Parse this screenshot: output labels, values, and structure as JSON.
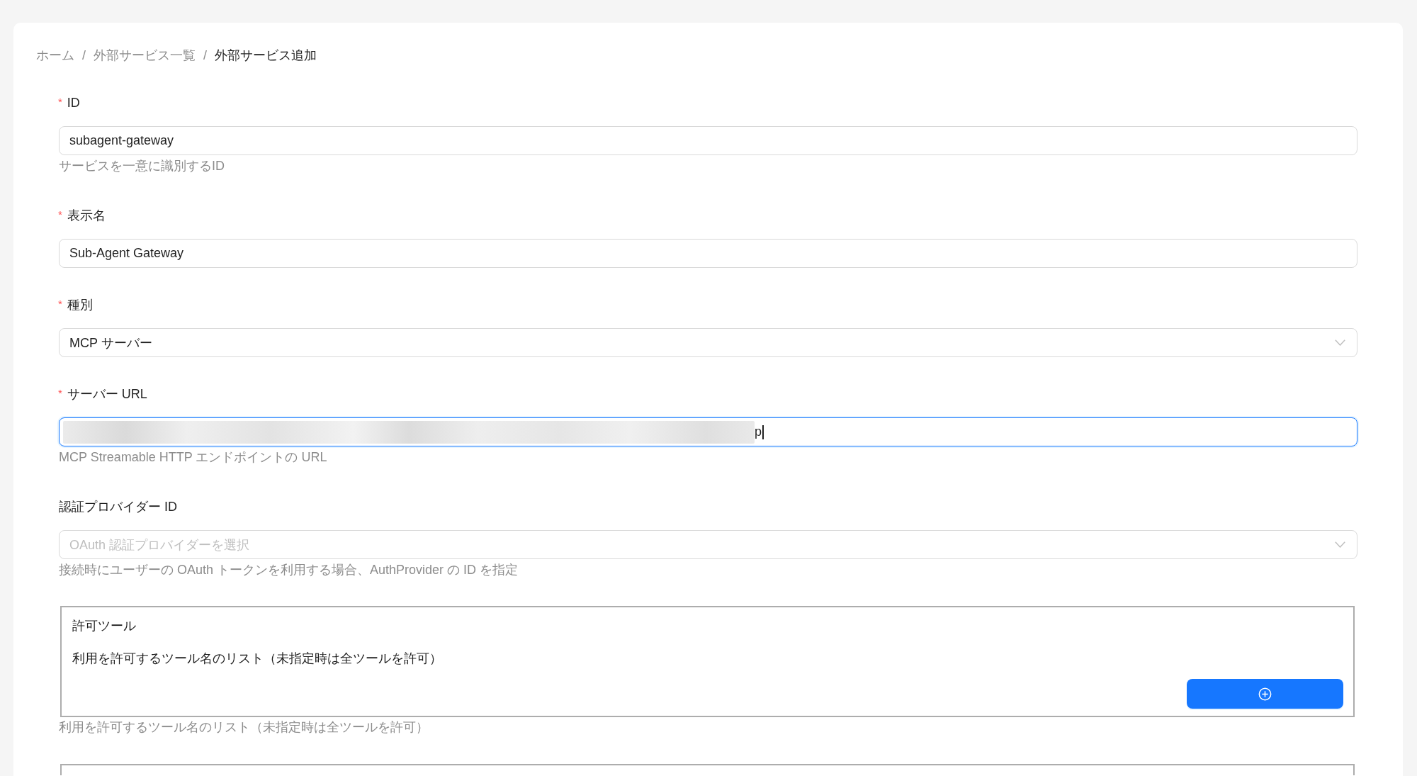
{
  "breadcrumb": {
    "items": [
      {
        "label": "ホーム",
        "current": false
      },
      {
        "label": "外部サービス一覧",
        "current": false
      },
      {
        "label": "外部サービス追加",
        "current": true
      }
    ],
    "separators": [
      "/",
      "/"
    ]
  },
  "fields": [
    {
      "kind": "text",
      "label": "ID",
      "required_mark": "*",
      "value": "subagent-gateway",
      "focused": false,
      "help": "サービスを一意に識別するID"
    },
    {
      "kind": "text",
      "label": "表示名",
      "required_mark": "*",
      "value": "Sub-Agent Gateway",
      "focused": false
    },
    {
      "kind": "select",
      "label": "種別",
      "required_mark": "*",
      "value": "MCP サーバー",
      "focused": false
    },
    {
      "kind": "text",
      "label": "サーバー URL",
      "required_mark": "*",
      "value": "p",
      "focused": true,
      "redacted": true,
      "help": "MCP Streamable HTTP エンドポイントの URL"
    },
    {
      "kind": "select",
      "label": "認証プロバイダー ID",
      "placeholder": "OAuth 認証プロバイダーを選択",
      "focused": false,
      "help": "接続時にユーザーの OAuth トークンを利用する場合、AuthProvider の ID を指定"
    },
    {
      "kind": "list",
      "title": "許可ツール",
      "description": "利用を許可するツール名のリスト（未指定時は全ツールを許可）",
      "help": "利用を許可するツール名のリスト（未指定時は全ツールを許可）"
    },
    {
      "kind": "list"
    }
  ]
}
